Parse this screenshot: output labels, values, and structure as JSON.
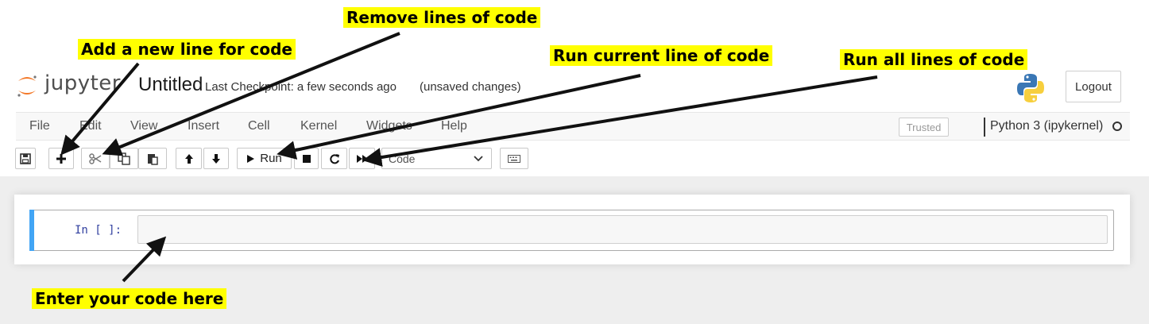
{
  "header": {
    "logo_text": "jupyter",
    "notebook_title": "Untitled",
    "checkpoint": "Last Checkpoint: a few seconds ago",
    "autosave_status": "(unsaved changes)",
    "logout_label": "Logout"
  },
  "menubar": {
    "items": [
      "File",
      "Edit",
      "View",
      "Insert",
      "Cell",
      "Kernel",
      "Widgets",
      "Help"
    ],
    "trusted_label": "Trusted",
    "kernel_name": "Python 3 (ipykernel)"
  },
  "toolbar": {
    "run_label": "Run",
    "cell_type": "Code"
  },
  "cell": {
    "prompt": "In [ ]:",
    "code": ""
  },
  "annotations": {
    "add_line": "Add a new line for code",
    "remove_lines": "Remove lines of code",
    "run_current": "Run current line of code",
    "run_all": "Run all lines of code",
    "enter_code": "Enter your code here"
  },
  "colors": {
    "highlight": "#ffff00",
    "jupyter_orange": "#f37726",
    "cell_selected": "#42a5f5",
    "prompt_blue": "#303f9f"
  },
  "icons": {
    "save": "floppy-disk-icon",
    "add": "plus-icon",
    "cut": "scissors-icon",
    "copy": "copy-icon",
    "paste": "paste-icon",
    "move_up": "arrow-up-icon",
    "move_down": "arrow-down-icon",
    "run": "play-icon",
    "interrupt": "stop-icon",
    "restart": "restart-icon",
    "run_all": "fast-forward-icon",
    "command_palette": "keyboard-icon"
  }
}
